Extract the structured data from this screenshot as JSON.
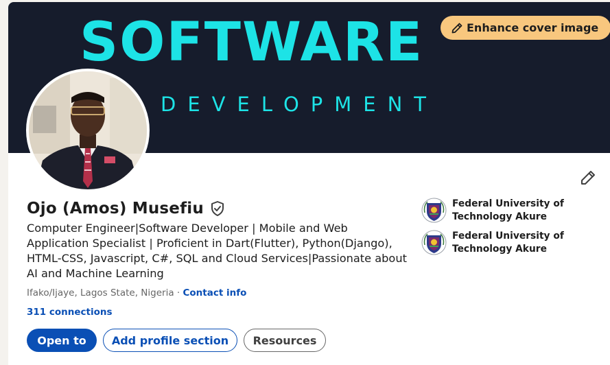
{
  "cover": {
    "title": "SOFTWARE",
    "subtitle": "DEVELOPMENT",
    "enhance_label": "Enhance cover image",
    "enhance_icon": "pencil-icon"
  },
  "profile": {
    "name": "Ojo (Amos) Musefiu",
    "verified_icon": "verified-shield-icon",
    "headline": "Computer Engineer|Software Developer | Mobile and Web Application Specialist | Proficient in Dart(Flutter), Python(Django), HTML-CSS, Javascript, C#, SQL and Cloud Services|Passionate about AI and Machine Learning",
    "location": "Ifako/Ijaye, Lagos State, Nigeria",
    "separator": "·",
    "contact_info": "Contact info",
    "connections": "311 connections",
    "edit_icon": "pencil-icon"
  },
  "education": [
    {
      "name": "Federal University of Technology Akure"
    },
    {
      "name": "Federal University of Technology Akure"
    }
  ],
  "actions": {
    "open_to": "Open to",
    "add_section": "Add profile section",
    "resources": "Resources"
  },
  "colors": {
    "accent": "#0a4fb5",
    "cover_bg": "#161c2c",
    "cover_text": "#1de3e6",
    "enhance_bg": "#f8c77e"
  }
}
